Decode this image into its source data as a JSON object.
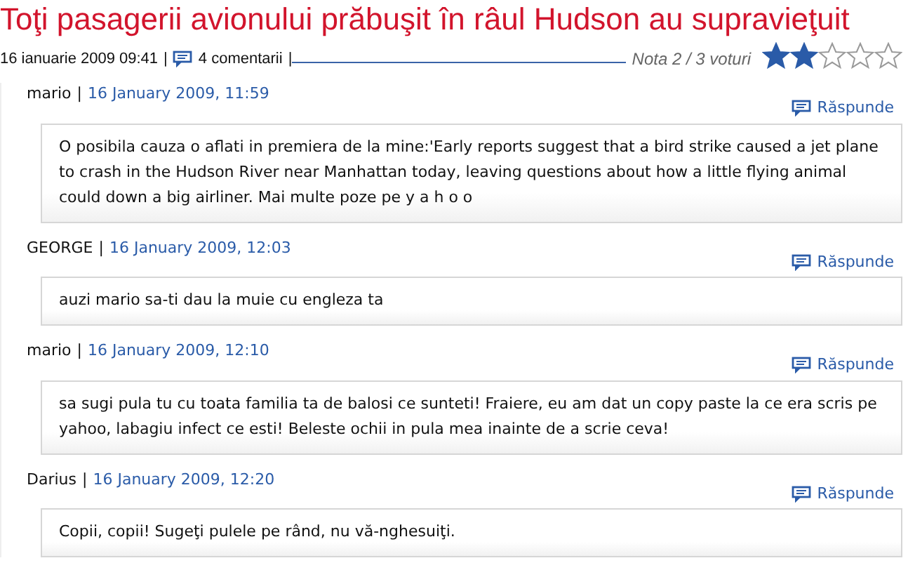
{
  "article": {
    "title": "Toţi pasagerii avionului prăbuşit în râul Hudson au supravieţuit",
    "date": "16 ianuarie 2009 09:41",
    "separator_1": "|",
    "comments_link": "4 comentarii",
    "separator_2": "|",
    "rating_label": "Nota 2 / 3 voturi",
    "stars": 2
  },
  "comments": [
    {
      "author": "mario",
      "separator": "|",
      "date": "16 January 2009, 11:59",
      "reply": "Răspunde",
      "text": "O posibila cauza o aflati in premiera de la mine:'Early reports suggest that a bird strike caused a jet plane to crash in the Hudson River near Manhattan today, leaving questions about how a little flying animal could down a big airliner. Mai multe poze pe y a h o o"
    },
    {
      "author": "GEORGE",
      "separator": "|",
      "date": "16 January 2009, 12:03",
      "reply": "Răspunde",
      "text": "auzi mario sa-ti dau la muie cu engleza ta"
    },
    {
      "author": "mario",
      "separator": "|",
      "date": "16 January 2009, 12:10",
      "reply": "Răspunde",
      "text": "sa sugi pula tu cu toata familia ta de balosi ce sunteti! Fraiere, eu am dat un copy paste la ce era scris pe yahoo, labagiu infect ce esti! Beleste ochii in pula mea inainte de a scrie ceva!"
    },
    {
      "author": "Darius",
      "separator": "|",
      "date": "16 January 2009, 12:20",
      "reply": "Răspunde",
      "text": "Copii, copii! Sugeţi pulele pe rând, nu vă-nghesuiţi."
    }
  ]
}
